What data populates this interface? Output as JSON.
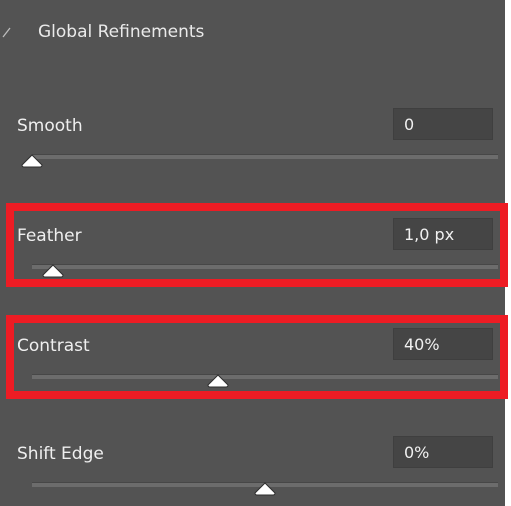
{
  "section": {
    "title": "Global Refinements",
    "expanded": true
  },
  "settings": [
    {
      "key": "smooth",
      "label": "Smooth",
      "value": "0",
      "slider_fraction": 0.0
    },
    {
      "key": "feather",
      "label": "Feather",
      "value": "1,0 px",
      "slider_fraction": 0.045
    },
    {
      "key": "contrast",
      "label": "Contrast",
      "value": "40%",
      "slider_fraction": 0.4
    },
    {
      "key": "shift-edge",
      "label": "Shift Edge",
      "value": "0%",
      "slider_fraction": 0.5
    }
  ],
  "highlighted": [
    "feather",
    "contrast"
  ],
  "colors": {
    "panel_bg": "#535353",
    "field_bg": "#454545",
    "track": "#6c6c6c",
    "thumb": "#ffffff",
    "highlight": "#ed1c24",
    "text": "#eaeaea"
  },
  "icons": {
    "section_toggle": "chevron-icon",
    "slider_thumb": "triangle-thumb-icon"
  }
}
